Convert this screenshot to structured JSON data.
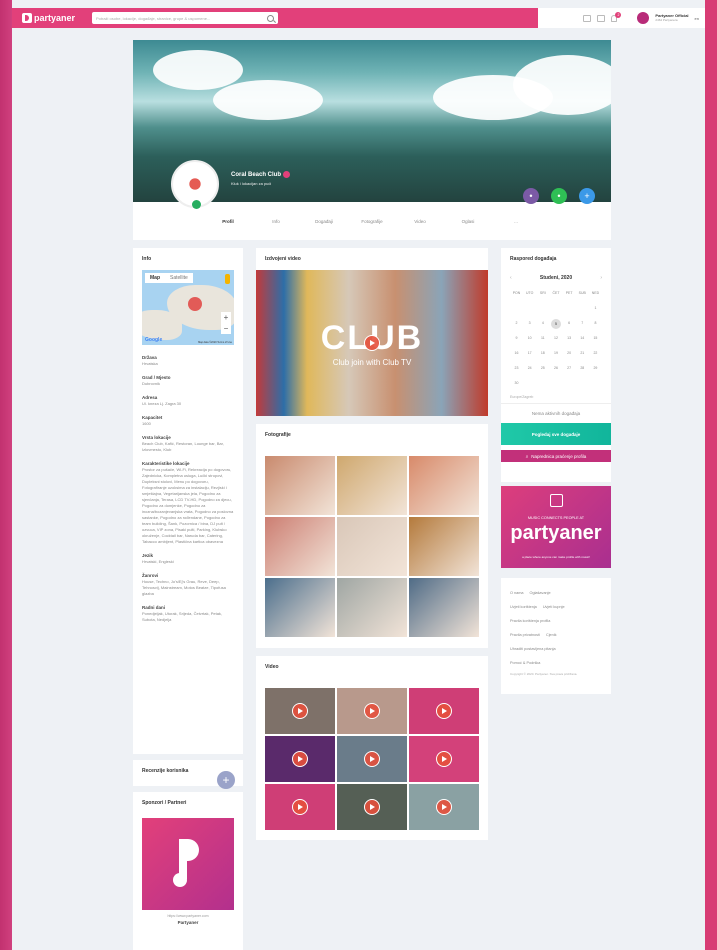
{
  "topbar": {
    "brand": "partyaner",
    "search_placeholder": "Potraži osobe, lokacije, događaje, stranice, grupe & uspomene...",
    "notif_count": "2",
    "user_name": "Partyaner Official",
    "user_sub": "2464 Partyanera",
    "lang": "en"
  },
  "profile": {
    "name": "Coral Beach Club",
    "subtitle": "Kluk i lokacijan za pući",
    "tabs": [
      "Profil",
      "Info",
      "Događaji",
      "Fotografije",
      "Video",
      "Oglasi",
      "..."
    ]
  },
  "info": {
    "title": "Info",
    "map_type_map": "Map",
    "map_type_satellite": "Satellite",
    "map_footer": "Map data ©2020  Terms of Use",
    "google": "Google",
    "fields": [
      {
        "label": "Država",
        "value": "Hrvatska"
      },
      {
        "label": "Grad / Mjesto",
        "value": "Dubrovnik"
      },
      {
        "label": "Adresa",
        "value": "Ul. kneza Lj. Zagra 30"
      },
      {
        "label": "Kapacitet",
        "value": "1600"
      },
      {
        "label": "Vrsta lokacije",
        "value": "Beach Club, Kafić, Restoran, Lounge bar, Bar, Izlovmesto, Klub"
      },
      {
        "label": "Karakteristike lokacije",
        "value": "Prostor za pušače, Wi-Fi, Rekreacija po dogovoru, Zajednicka, Kompletna usluga, Lučki stropovi, Dupleksni stolovi, Menu po dogovoru, Fotografiranje uzoksima za instalaciju, Rezjiski i smještajna, Vegetarijanska jela, Pogodno za sjenčanja, Terasa, LCD TV-HD, Pogodno za djecu, Pogodno za domjenke, Pogodno za inozna/bozanjevanjska vrata, Pogodno za poslovna sastanke, Pogodno za rođendane, Pogodno za team building, Šank, Pozornica / bina, DJ pult / ozvuca, VIP zona, Pisaki pulti, Parking, Klubsko okruženje, Cocktail bar, Naruda bar, Catering, Tabacco ambijent, Plastična kartica obavezna"
      },
      {
        "label": "Jezik",
        "value": "Hrvatski, Engleski"
      },
      {
        "label": "Žanrovi",
        "value": "House, Techno, Jo's/Ej's Grau, Reve, Deep, Tehnosvij, Mainstream, Motos Beatze, Tipofusa glazba"
      },
      {
        "label": "Radni dani",
        "value": "Ponedjeljak, Utorak, Srijeda, Četvrtak, Petak, Subota, Nedjelja"
      }
    ]
  },
  "reviews": {
    "title": "Recenzije korisnika",
    "add": "+"
  },
  "sponsors": {
    "title": "Sponzori / Partneri",
    "url": "https://www.partyaner.com",
    "name": "Partyaner"
  },
  "video_featured": {
    "title": "Izdvojeni video",
    "logo": "CLUB",
    "tagline": "Club join with Club TV"
  },
  "photos": {
    "title": "Fotografije",
    "colors": [
      "#c98a6e",
      "#cfa86e",
      "#d88a6a",
      "#cc7e72",
      "#d9c7b8",
      "#b47a3c",
      "#4b6e8c",
      "#9fa6a3",
      "#4f6b86"
    ]
  },
  "videos": {
    "title": "Video",
    "colors": [
      "#7e7169",
      "#b8998c",
      "#cf3e76",
      "#5a2a6b",
      "#6a7c8a",
      "#d3417a",
      "#cf3e76",
      "#555f55",
      "#8aa1a3"
    ]
  },
  "calendar": {
    "title": "Raspored događaja",
    "month": "Studeni, 2020",
    "prev": "‹",
    "next": "›",
    "weekdays": [
      "PON",
      "UTO",
      "SRI",
      "ČET",
      "PET",
      "SUB",
      "NED"
    ],
    "days": [
      "",
      "",
      "",
      "",
      "",
      "",
      "1",
      "2",
      "3",
      "4",
      "5",
      "6",
      "7",
      "8",
      "9",
      "10",
      "11",
      "12",
      "13",
      "14",
      "15",
      "16",
      "17",
      "18",
      "19",
      "20",
      "21",
      "22",
      "23",
      "24",
      "25",
      "26",
      "27",
      "28",
      "29",
      "30",
      "",
      "",
      "",
      "",
      "",
      ""
    ],
    "today": "5",
    "timezone": "Europe/Zagreb",
    "empty": "Nema aktivnih događaja",
    "btn_all": "Pogledaj sve događaje",
    "btn_promo": "Naprednica praćenje profila"
  },
  "banner": {
    "slogan": "MUSIC CONNECTS PEOPLE AT",
    "brand": "partyaner",
    "sub": "a place where anyone can make profile with music!"
  },
  "footer_links": [
    [
      "O nama",
      "Oglašavanje"
    ],
    [
      "Uvjeti korištenja",
      "Uvjeti kupnje"
    ],
    [
      "Pravila korištenja profila"
    ],
    [
      "Pravila privatnosti",
      "Cjenik"
    ],
    [
      "Uhraditi postavljena pitanja"
    ],
    [
      "Pomoć & Podrška"
    ]
  ],
  "copyright": "Copyright © 2020. Partyaner. Sva prava pridržana."
}
